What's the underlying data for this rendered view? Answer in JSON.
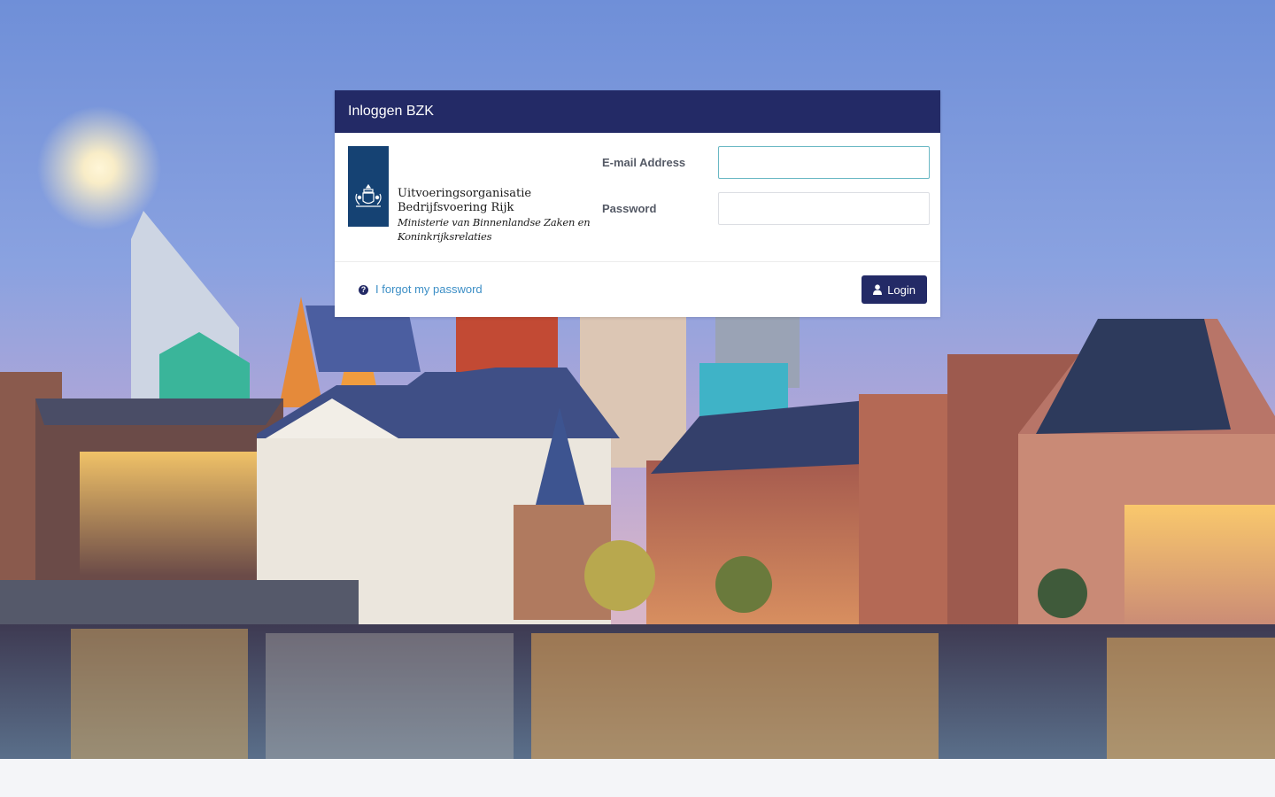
{
  "card": {
    "title": "Inloggen BZK"
  },
  "logo": {
    "line1": "Uitvoeringsorganisatie",
    "line2": "Bedrijfsvoering Rijk",
    "line3": "Ministerie van Binnenlandse Zaken en",
    "line4": "Koninkrijksrelaties",
    "icon": "rijksoverheid-emblem-icon"
  },
  "form": {
    "email_label": "E-mail Address",
    "email_value": "",
    "password_label": "Password",
    "password_value": ""
  },
  "footer": {
    "forgot_label": "I forgot my password",
    "forgot_icon": "question-circle-icon",
    "login_label": "Login",
    "login_icon": "user-icon"
  },
  "colors": {
    "header": "#232a66",
    "button": "#232a66",
    "link": "#3d8fc6",
    "logo_bar": "#154273",
    "input_focus_border": "#6ab8c4"
  }
}
